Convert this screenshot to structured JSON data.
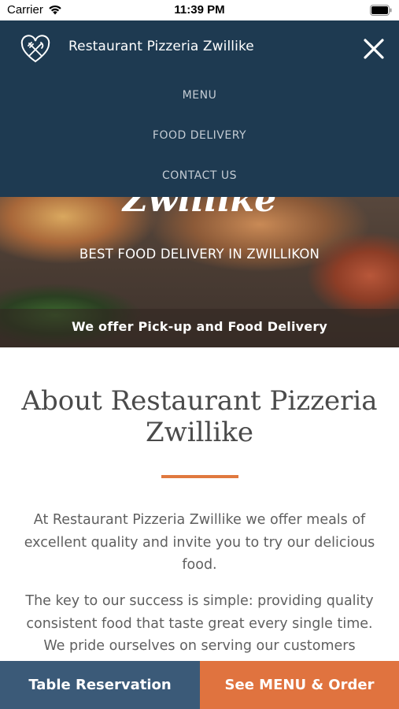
{
  "status_bar": {
    "carrier": "Carrier",
    "time": "11:39 PM"
  },
  "nav": {
    "brand": "Restaurant Pizzeria Zwillike",
    "logo_icon": "fork-knife-heart-icon",
    "close_icon": "close-icon",
    "links": [
      "MENU",
      "FOOD DELIVERY",
      "CONTACT US"
    ]
  },
  "hero": {
    "title": "Zwillike",
    "subtitle": "BEST FOOD DELIVERY IN ZWILLIKON",
    "band_text": "We offer Pick-up and Food Delivery"
  },
  "about": {
    "heading": "About Restaurant Pizzeria Zwillike",
    "paragraph_1": "At Restaurant Pizzeria Zwillike we offer meals of excellent quality and invite you to try our delicious food.",
    "paragraph_2": "The key to our success is simple: providing quality consistent food that taste great every single time. We pride ourselves on serving our customers"
  },
  "bottom_bar": {
    "reservation_label": "Table Reservation",
    "order_label": "See MENU & Order"
  },
  "colors": {
    "nav_bg": "#1e3a51",
    "accent_orange": "#e0733f",
    "reservation_bg": "#3b5a78"
  }
}
